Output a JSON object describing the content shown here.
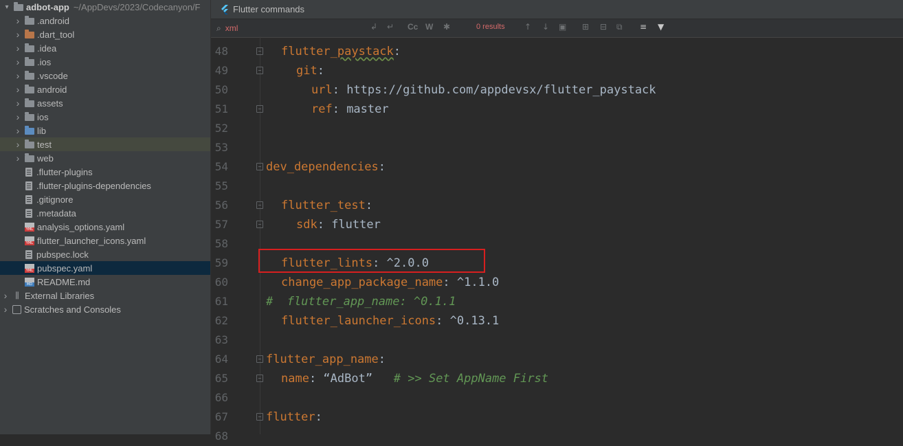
{
  "sidebar": {
    "root": {
      "name": "adbot-app",
      "path": "~/AppDevs/2023/Codecanyon/F"
    },
    "items": [
      {
        "label": ".android",
        "icon": "folder",
        "arrow": true
      },
      {
        "label": ".dart_tool",
        "icon": "folder-orange",
        "arrow": true
      },
      {
        "label": ".idea",
        "icon": "folder",
        "arrow": true
      },
      {
        "label": ".ios",
        "icon": "folder",
        "arrow": true
      },
      {
        "label": ".vscode",
        "icon": "folder",
        "arrow": true
      },
      {
        "label": "android",
        "icon": "folder",
        "arrow": true
      },
      {
        "label": "assets",
        "icon": "folder",
        "arrow": true
      },
      {
        "label": "ios",
        "icon": "folder",
        "arrow": true
      },
      {
        "label": "lib",
        "icon": "folder-blue",
        "arrow": true
      },
      {
        "label": "test",
        "icon": "folder",
        "arrow": true
      },
      {
        "label": "web",
        "icon": "folder",
        "arrow": true
      },
      {
        "label": ".flutter-plugins",
        "icon": "file"
      },
      {
        "label": ".flutter-plugins-dependencies",
        "icon": "file"
      },
      {
        "label": ".gitignore",
        "icon": "file"
      },
      {
        "label": ".metadata",
        "icon": "file"
      },
      {
        "label": "analysis_options.yaml",
        "icon": "yaml"
      },
      {
        "label": "flutter_launcher_icons.yaml",
        "icon": "yaml"
      },
      {
        "label": "pubspec.lock",
        "icon": "file"
      },
      {
        "label": "pubspec.yaml",
        "icon": "yaml"
      },
      {
        "label": "README.md",
        "icon": "md"
      }
    ],
    "external_libraries": "External Libraries",
    "scratches": "Scratches and Consoles"
  },
  "tab": {
    "title": "Flutter commands"
  },
  "search": {
    "value": "xml",
    "results": "0 results"
  },
  "code": [
    {
      "n": "48",
      "indent": 2,
      "parts": [
        [
          "k",
          "flutter_"
        ],
        [
          "ksq",
          "paystack"
        ],
        [
          "v",
          ":"
        ]
      ]
    },
    {
      "n": "49",
      "indent": 4,
      "parts": [
        [
          "k",
          "git"
        ],
        [
          "v",
          ":"
        ]
      ]
    },
    {
      "n": "50",
      "indent": 6,
      "parts": [
        [
          "k",
          "url"
        ],
        [
          "v",
          ": https://github.com/appdevsx/flutter_paystack"
        ]
      ]
    },
    {
      "n": "51",
      "indent": 6,
      "parts": [
        [
          "k",
          "ref"
        ],
        [
          "v",
          ": master"
        ]
      ]
    },
    {
      "n": "52",
      "indent": 0,
      "parts": []
    },
    {
      "n": "53",
      "indent": 0,
      "parts": []
    },
    {
      "n": "54",
      "indent": 0,
      "parts": [
        [
          "k",
          "dev_dependencies"
        ],
        [
          "v",
          ":"
        ]
      ]
    },
    {
      "n": "55",
      "indent": 0,
      "parts": []
    },
    {
      "n": "56",
      "indent": 2,
      "parts": [
        [
          "k",
          "flutter_test"
        ],
        [
          "v",
          ":"
        ]
      ]
    },
    {
      "n": "57",
      "indent": 4,
      "parts": [
        [
          "k",
          "sdk"
        ],
        [
          "v",
          ": flutter"
        ]
      ]
    },
    {
      "n": "58",
      "indent": 0,
      "parts": []
    },
    {
      "n": "59",
      "indent": 2,
      "parts": [
        [
          "k",
          "flutter_lints"
        ],
        [
          "v",
          ": ^2.0.0"
        ]
      ]
    },
    {
      "n": "60",
      "indent": 2,
      "parts": [
        [
          "k",
          "change_app_package_name"
        ],
        [
          "v",
          ": ^1.1.0"
        ]
      ]
    },
    {
      "n": "61",
      "indent": 0,
      "parts": [
        [
          "c",
          "#  flutter_app_name: ^0.1.1"
        ]
      ]
    },
    {
      "n": "62",
      "indent": 2,
      "parts": [
        [
          "k",
          "flutter_launcher_icons"
        ],
        [
          "v",
          ": ^0.13.1"
        ]
      ]
    },
    {
      "n": "63",
      "indent": 0,
      "parts": []
    },
    {
      "n": "64",
      "indent": 0,
      "parts": [
        [
          "k",
          "flutter_app_name"
        ],
        [
          "v",
          ":"
        ]
      ]
    },
    {
      "n": "65",
      "indent": 2,
      "parts": [
        [
          "k",
          "name"
        ],
        [
          "v",
          ": “AdBot”   "
        ],
        [
          "c",
          "# >> Set AppName First"
        ]
      ]
    },
    {
      "n": "66",
      "indent": 0,
      "parts": []
    },
    {
      "n": "67",
      "indent": 0,
      "parts": [
        [
          "k",
          "flutter"
        ],
        [
          "v",
          ":"
        ]
      ]
    },
    {
      "n": "68",
      "indent": 0,
      "parts": []
    }
  ]
}
